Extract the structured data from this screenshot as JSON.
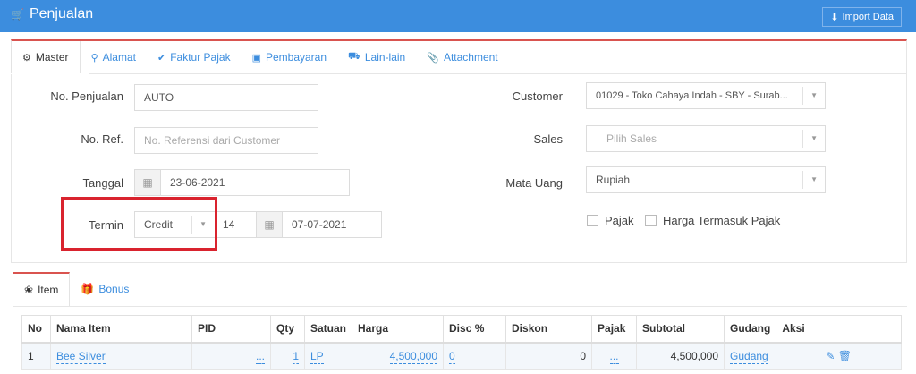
{
  "header": {
    "title": "Penjualan",
    "import_label": "Import Data"
  },
  "tabs": [
    "Master",
    "Alamat",
    "Faktur Pajak",
    "Pembayaran",
    "Lain-lain",
    "Attachment"
  ],
  "form": {
    "no_penjualan_label": "No. Penjualan",
    "no_penjualan_value": "AUTO",
    "no_ref_label": "No. Ref.",
    "no_ref_placeholder": "No. Referensi dari Customer",
    "tanggal_label": "Tanggal",
    "tanggal_value": "23-06-2021",
    "termin_label": "Termin",
    "termin_value": "Credit",
    "termin_days": "14",
    "termin_date": "07-07-2021",
    "customer_label": "Customer",
    "customer_value": "01029 - Toko Cahaya Indah - SBY - Surab...",
    "sales_label": "Sales",
    "sales_placeholder": "Pilih Sales",
    "mata_uang_label": "Mata Uang",
    "mata_uang_value": "Rupiah",
    "pajak_label": "Pajak",
    "harga_termasuk_pajak_label": "Harga Termasuk Pajak"
  },
  "bottom_tabs": [
    "Item",
    "Bonus"
  ],
  "table": {
    "headers": [
      "No",
      "Nama Item",
      "PID",
      "Qty",
      "Satuan",
      "Harga",
      "Disc %",
      "Diskon",
      "Pajak",
      "Subtotal",
      "Gudang",
      "Aksi"
    ],
    "rows": [
      {
        "no": "1",
        "nama": "Bee Silver",
        "pid": "...",
        "qty": "1",
        "satuan": "LP",
        "harga": "4,500,000",
        "disc": "0",
        "diskon": "0",
        "pajak": "...",
        "subtotal": "4,500,000",
        "gudang": "Gudang"
      }
    ]
  },
  "colors": {
    "accent": "#3c8dde",
    "highlight": "#d9232e"
  }
}
